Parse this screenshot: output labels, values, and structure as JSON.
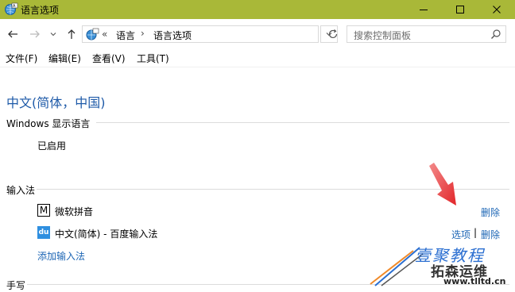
{
  "window": {
    "title": "语言选项",
    "colors": {
      "title_bg": "#a9b838",
      "link": "#1d66b5",
      "heading": "#1e5aa8"
    }
  },
  "address": {
    "overflow": "«",
    "crumbs": [
      "语言",
      "语言选项"
    ],
    "separator": "›"
  },
  "search": {
    "placeholder": "搜索控制面板"
  },
  "menu": [
    "文件(F)",
    "编辑(E)",
    "查看(V)",
    "工具(T)"
  ],
  "page": {
    "language_title": "中文(简体，中国)",
    "display_language": {
      "heading": "Windows 显示语言",
      "status": "已启用"
    },
    "input_methods": {
      "heading": "输入法",
      "items": [
        {
          "icon_text": "M",
          "icon": "microsoft-pinyin-icon",
          "name": "微软拼音",
          "actions": [
            "删除"
          ]
        },
        {
          "icon_text": "du",
          "icon": "baidu-ime-icon",
          "name": "中文(简体) - 百度输入法",
          "actions": [
            "选项",
            "删除"
          ],
          "action_divider": "|"
        }
      ],
      "add_link": "添加输入法"
    },
    "handwriting": {
      "heading": "手写"
    }
  },
  "watermark": {
    "line1": "壹聚教程",
    "line2": "拓森运维",
    "url": "www.tlltd.cn"
  }
}
